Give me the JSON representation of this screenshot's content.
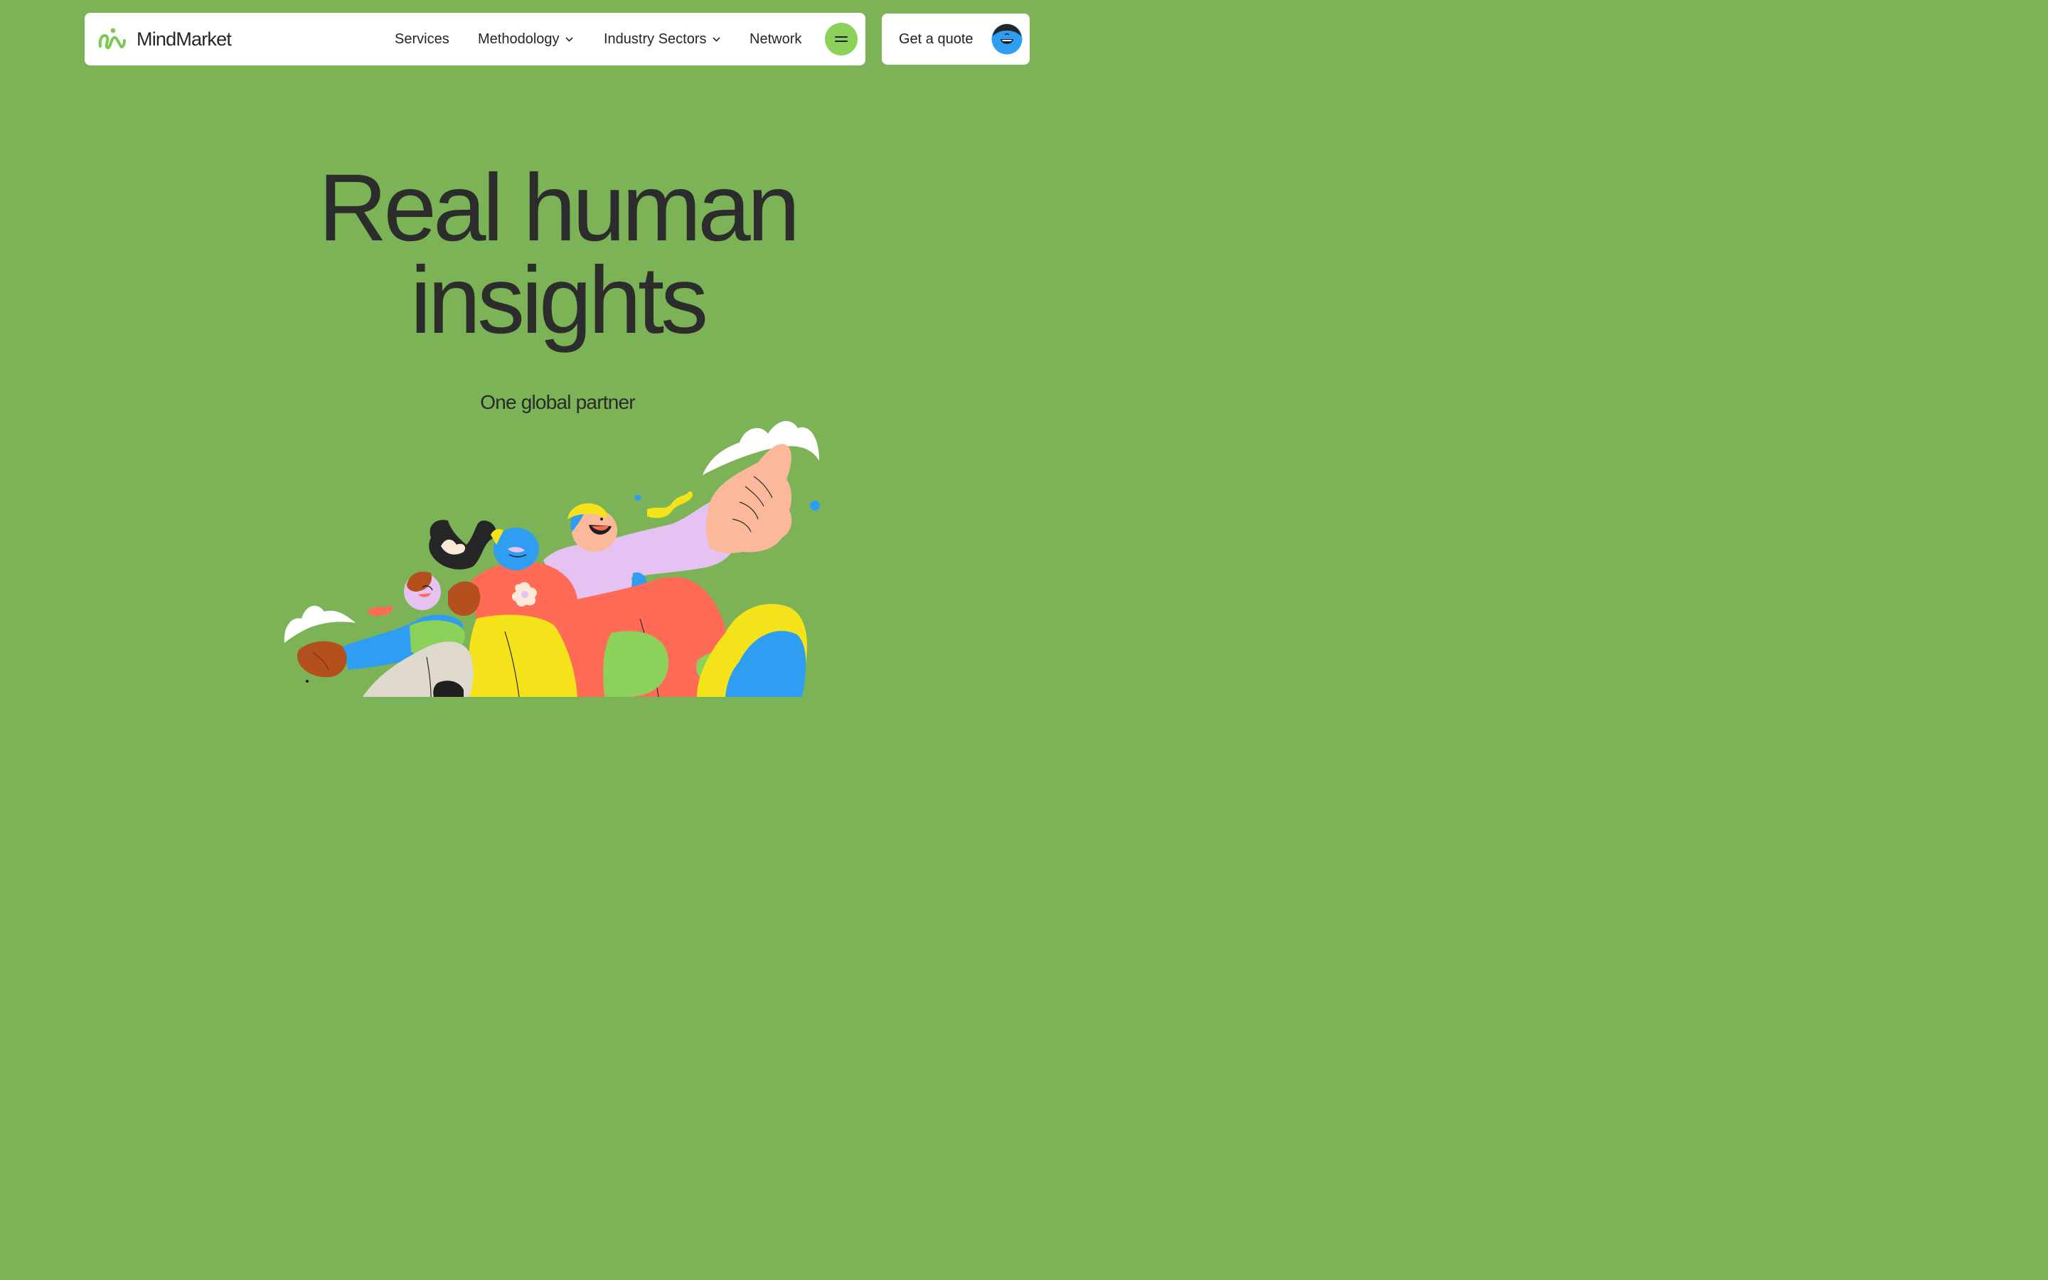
{
  "brand": {
    "name": "MindMarket",
    "logo_icon": "brand-logo-icon",
    "accent": "#8bd15a"
  },
  "nav": {
    "items": [
      {
        "label": "Services",
        "has_dropdown": false
      },
      {
        "label": "Methodology",
        "has_dropdown": true
      },
      {
        "label": "Industry Sectors",
        "has_dropdown": true
      },
      {
        "label": "Network",
        "has_dropdown": false
      }
    ],
    "menu_icon": "menu-icon"
  },
  "cta": {
    "label": "Get a quote",
    "avatar_icon": "avatar-icon"
  },
  "hero": {
    "title_line1": "Real human",
    "title_line2": "insights",
    "subtitle": "One global partner"
  },
  "colors": {
    "background": "#7bb356",
    "text": "#262626",
    "blue": "#2e9df2",
    "red": "#ff6b57",
    "yellow": "#f4e21a",
    "pink": "#e6c2f3"
  }
}
